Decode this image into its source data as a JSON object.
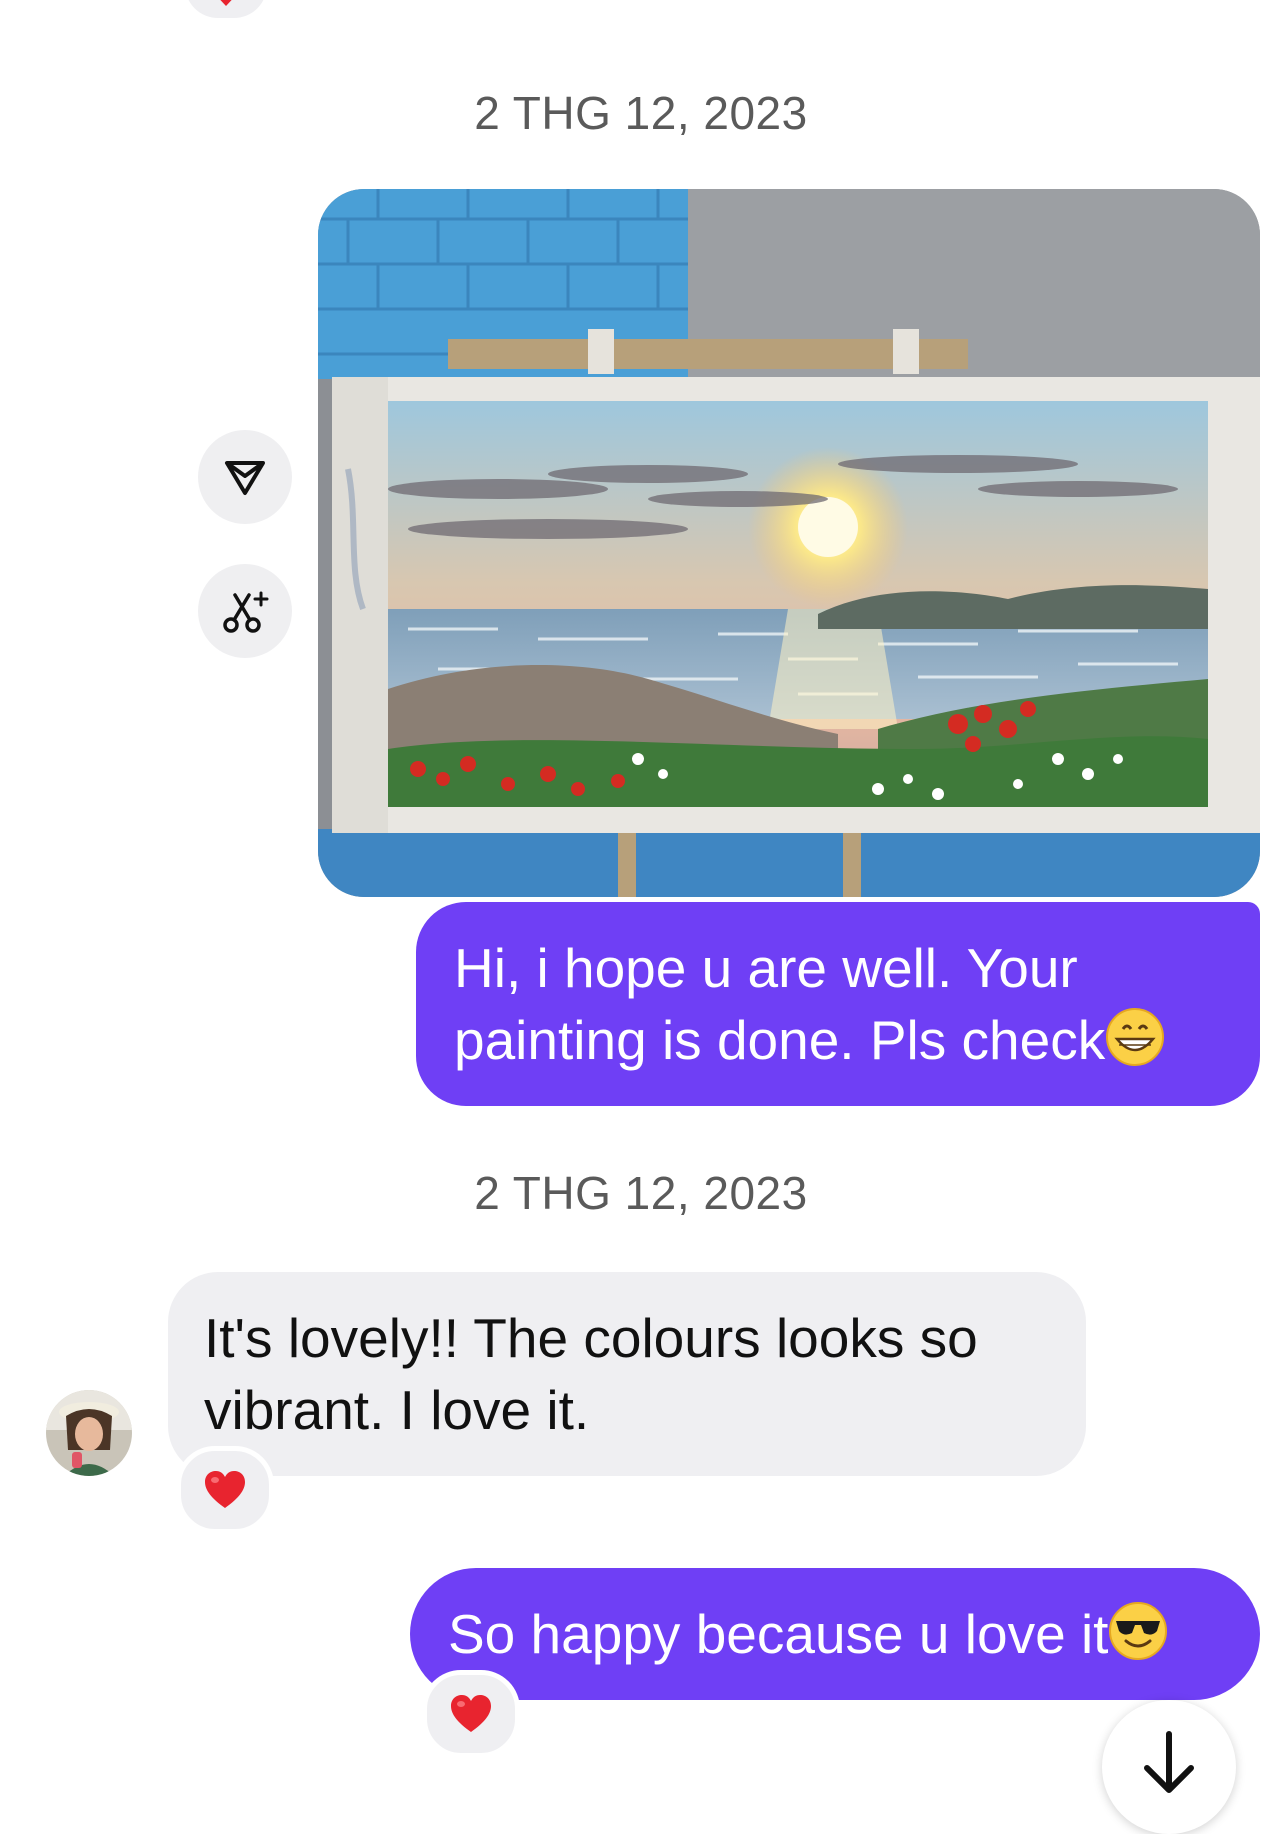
{
  "conversation": {
    "date_separators": [
      "2 THG 12, 2023",
      "2 THG 12, 2023"
    ],
    "messages": [
      {
        "sender": "me",
        "type": "image",
        "image_alt": "Painting of a sunset over the sea with flowers in the foreground on an easel"
      },
      {
        "sender": "me",
        "type": "text",
        "text_line1": "Hi, i hope u are well. Your",
        "text_line2": "painting is done. Pls check",
        "emoji": "grinning-face"
      },
      {
        "sender": "other",
        "type": "text",
        "text_line1": "It's lovely!! The colours looks so",
        "text_line2": "vibrant. I love it.",
        "reaction": "heart"
      },
      {
        "sender": "me",
        "type": "text",
        "text_line1": "So happy because u love it",
        "emoji": "smiling-face-with-sunglasses",
        "reaction": "heart"
      }
    ]
  },
  "icons": {
    "share": "send-icon",
    "ai_edit": "scissors-sparkle-icon",
    "reaction": "heart-icon",
    "scroll": "arrow-down-icon"
  },
  "colors": {
    "outgoing_bubble": "#6f3ff5",
    "incoming_bubble": "#efeff2",
    "heart": "#e8242f",
    "date_text": "#5a5a5a"
  }
}
